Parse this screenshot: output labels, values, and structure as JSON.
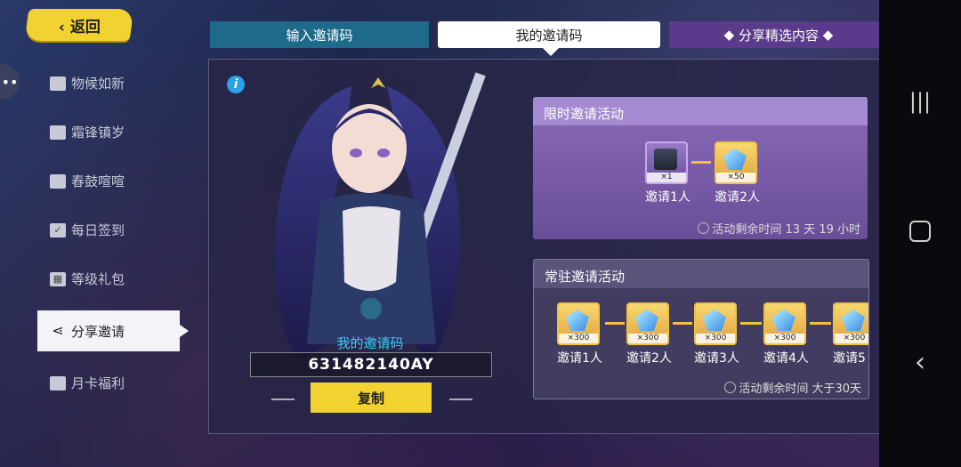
{
  "back_label": "返回",
  "sidebar": {
    "items": [
      {
        "label": "物候如新",
        "icon": "calendar-icon"
      },
      {
        "label": "霜锋镇岁",
        "icon": "calendar-icon"
      },
      {
        "label": "春鼓喧喧",
        "icon": "calendar-icon"
      },
      {
        "label": "每日签到",
        "icon": "check-calendar-icon"
      },
      {
        "label": "等级礼包",
        "icon": "gift-icon"
      },
      {
        "label": "分享邀请",
        "icon": "share-icon"
      },
      {
        "label": "月卡福利",
        "icon": "card-icon"
      }
    ]
  },
  "tabs": {
    "input_code": "输入邀请码",
    "my_code": "我的邀请码",
    "share": "分享精选内容"
  },
  "invite": {
    "label": "我的邀请码",
    "code": "631482140AY",
    "copy": "复制"
  },
  "limited": {
    "title": "限时邀请活动",
    "rewards": [
      {
        "qty": "×1",
        "label": "邀请1人",
        "kind": "chest"
      },
      {
        "qty": "×50",
        "label": "邀请2人",
        "kind": "crystal"
      }
    ],
    "timer": "活动剩余时间 13 天 19 小时"
  },
  "permanent": {
    "title": "常驻邀请活动",
    "rewards": [
      {
        "qty": "×300",
        "label": "邀请1人"
      },
      {
        "qty": "×300",
        "label": "邀请2人"
      },
      {
        "qty": "×300",
        "label": "邀请3人"
      },
      {
        "qty": "×300",
        "label": "邀请4人"
      },
      {
        "qty": "×300",
        "label": "邀请5"
      }
    ],
    "timer": "活动剩余时间 大于30天"
  }
}
